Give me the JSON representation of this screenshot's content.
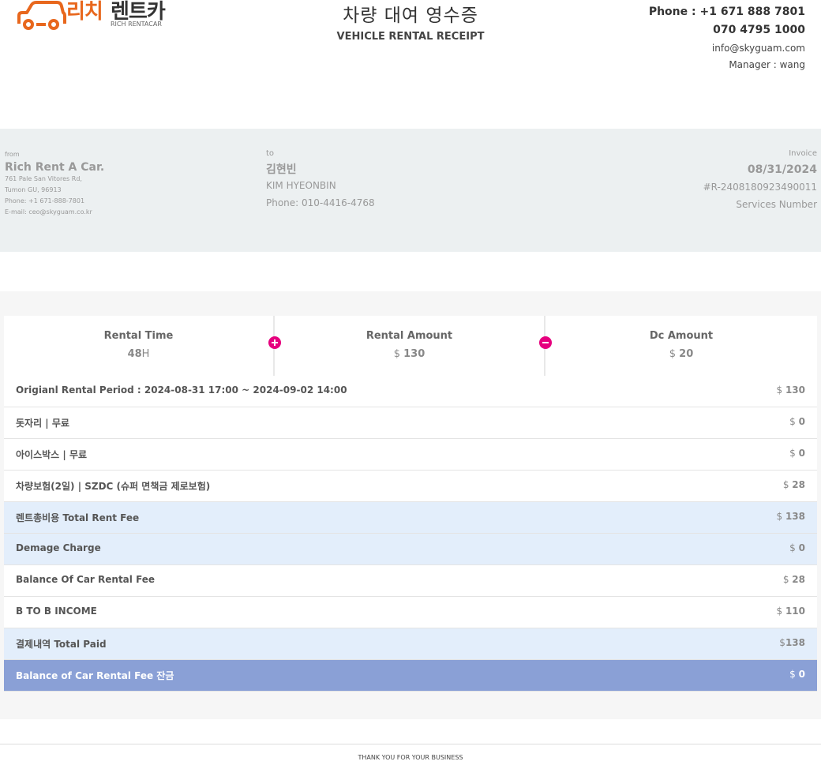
{
  "header": {
    "logo": {
      "kr_part1": "리치",
      "kr_part2": "렌트카",
      "en": "RICH RENTACAR"
    },
    "title_kr": "차량 대여 영수증",
    "title_en": "VEHICLE RENTAL RECEIPT",
    "contact": {
      "phone1": "Phone : +1 671 888 7801",
      "phone2": "070 4795 1000",
      "email": "info@skyguam.com",
      "manager": "Manager : wang"
    }
  },
  "info": {
    "from": {
      "label": "from",
      "name": "Rich Rent A Car.",
      "address1": "761 Pale San Vitores Rd,",
      "address2": "Tumon GU, 96913",
      "phone": "Phone: +1 671-888-7801",
      "email": "E-mail: ceo@skyguam.co.kr"
    },
    "to": {
      "label": "to",
      "name_kr": "김현빈",
      "name_en": "KIM HYEONBIN",
      "phone": "Phone: 010-4416-4768"
    },
    "invoice": {
      "label": "Invoice",
      "date": "08/31/2024",
      "number": "#R-2408180923490011",
      "services_label": "Services Number"
    }
  },
  "summary": {
    "rental_time": {
      "label": "Rental Time",
      "value": "48",
      "unit": "H"
    },
    "rental_amount": {
      "label": "Rental Amount",
      "currency": "$",
      "value": "130"
    },
    "dc_amount": {
      "label": "Dc Amount",
      "currency": "$",
      "value": "20"
    }
  },
  "rows": [
    {
      "desc": "Origianl Rental Period : 2024-08-31 17:00 ~ 2024-09-02 14:00",
      "cur": "$",
      "amount": "130"
    },
    {
      "desc": "돗자리 | 무료",
      "cur": "$",
      "amount": "0"
    },
    {
      "desc": "아이스박스 | 무료",
      "cur": "$",
      "amount": "0"
    },
    {
      "desc": "차량보험(2일) | SZDC (슈퍼 면책금 제로보험)",
      "cur": "$",
      "amount": "28"
    },
    {
      "desc": "렌트총비용 Total Rent Fee",
      "cur": "$",
      "amount": "138"
    },
    {
      "desc": "Demage Charge",
      "cur": "$",
      "amount": "0"
    },
    {
      "desc": "Balance Of Car Rental Fee",
      "cur": "$",
      "amount": "28"
    },
    {
      "desc": "B TO B INCOME",
      "cur": "$",
      "amount": "110"
    },
    {
      "desc": "결제내역 Total Paid",
      "cur": "$",
      "amount": "138"
    },
    {
      "desc": "Balance of Car Rental Fee 잔금",
      "cur": "$",
      "amount": "0"
    }
  ],
  "footer": {
    "text": "THANK YOU FOR YOUR BUSINESS"
  },
  "colors": {
    "brand_orange": "#e8671d",
    "accent_pink": "#e6007e",
    "highlight_blue": "#e3eefb",
    "total_blue": "#8aa0d6",
    "band_gray": "#ecf0f1"
  }
}
